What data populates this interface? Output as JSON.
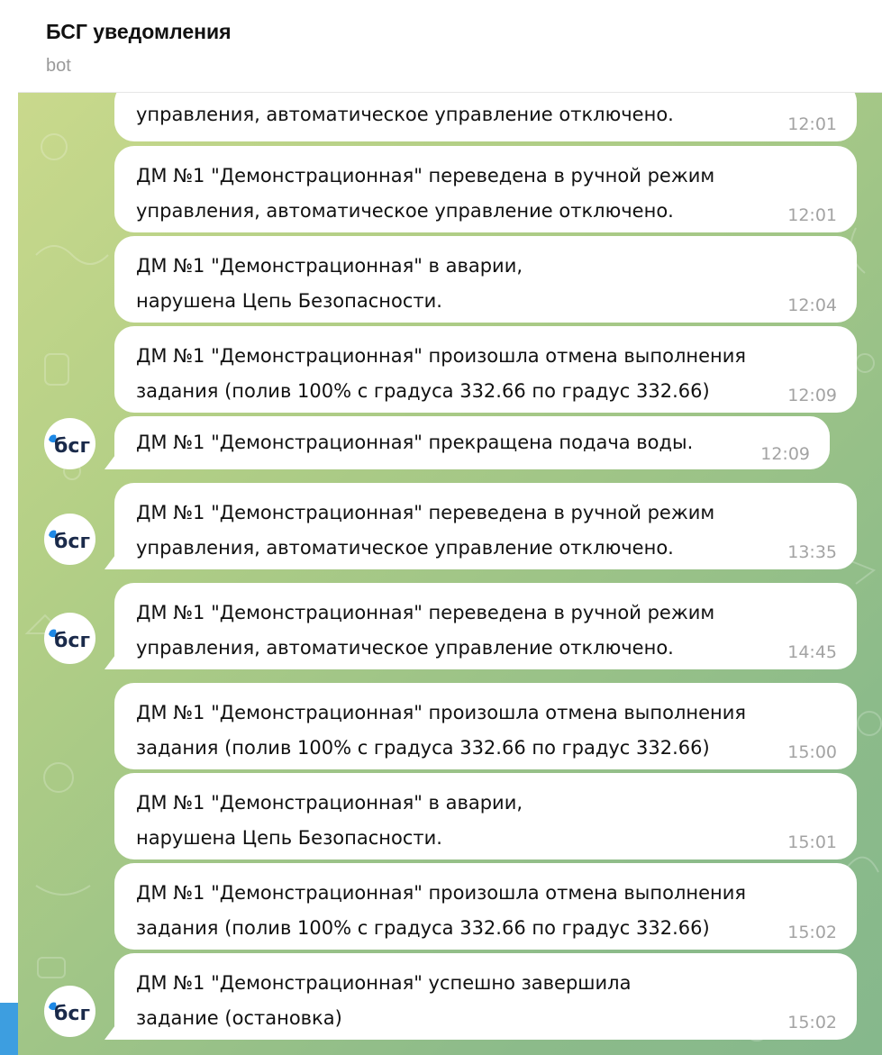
{
  "header": {
    "title": "БСГ уведомления",
    "subtitle": "bot"
  },
  "avatar": {
    "logo_text": "бсг",
    "accent_color": "#1e88e5",
    "text_color": "#1a2a4a"
  },
  "messages": [
    {
      "text": "управления, автоматическое управление отключено.",
      "time": "12:01"
    },
    {
      "text": "ДМ №1 \"Демонстрационная\" переведена в ручной режим управления, автоматическое управление отключено.",
      "time": "12:01"
    },
    {
      "text": "ДМ №1 \"Демонстрационная\" в аварии, нарушена Цепь Безопасности.",
      "time": "12:04"
    },
    {
      "text": "ДМ №1 \"Демонстрационная\" произошла отмена выполнения задания (полив 100% с градуса 332.66 по градус 332.66)",
      "time": "12:09"
    },
    {
      "text": "ДМ №1 \"Демонстрационная\" прекращена подача воды.",
      "time": "12:09"
    },
    {
      "text": "ДМ №1 \"Демонстрационная\" переведена в ручной режим управления, автоматическое управление отключено.",
      "time": "13:35"
    },
    {
      "text": "ДМ №1 \"Демонстрационная\" переведена в ручной режим управления, автоматическое управление отключено.",
      "time": "14:45"
    },
    {
      "text": "ДМ №1 \"Демонстрационная\" произошла отмена выполнения задания (полив 100% с градуса 332.66 по градус 332.66)",
      "time": "15:00"
    },
    {
      "text": "ДМ №1 \"Демонстрационная\" в аварии, нарушена Цепь Безопасности.",
      "time": "15:01"
    },
    {
      "text": "ДМ №1 \"Демонстрационная\" произошла отмена выполнения задания (полив 100% с градуса 332.66 по градус 332.66)",
      "time": "15:02"
    },
    {
      "text": "ДМ №1 \"Демонстрационная\" успешно завершила задание (остановка)",
      "time": "15:02"
    }
  ],
  "colors": {
    "bubble": "#ffffff",
    "time": "#a3a3a3",
    "wallpaper_start": "#c9d98c",
    "wallpaper_end": "#86b88c"
  }
}
